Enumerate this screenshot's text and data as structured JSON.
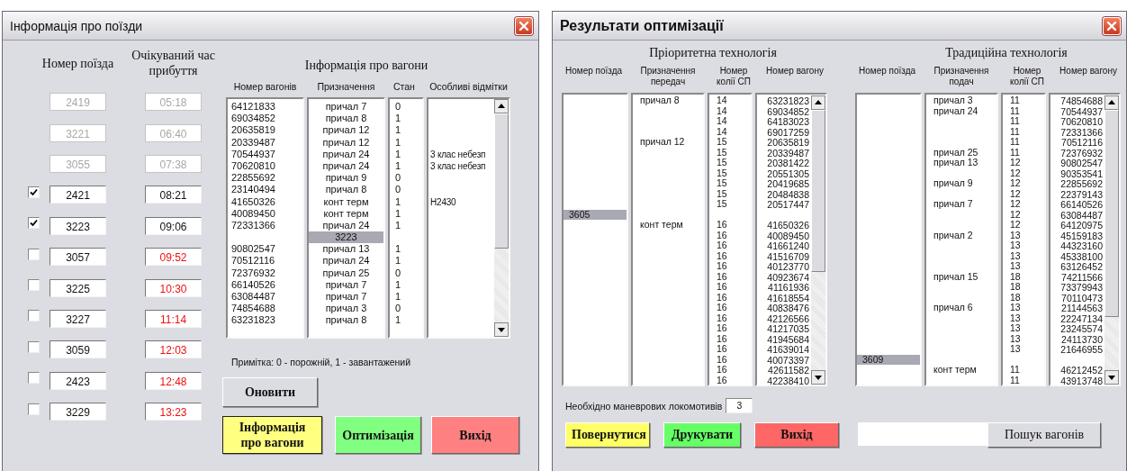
{
  "left_window": {
    "title": "Інформація про поїзди",
    "train_headers": [
      "Номер поїзда",
      "Очікуваний час прибуття"
    ],
    "trains": [
      {
        "number": "2419",
        "time": "05:18",
        "disabled": true,
        "checked": false,
        "late": false
      },
      {
        "number": "3221",
        "time": "06:40",
        "disabled": true,
        "checked": false,
        "late": false
      },
      {
        "number": "3055",
        "time": "07:38",
        "disabled": true,
        "checked": false,
        "late": false
      },
      {
        "number": "2421",
        "time": "08:21",
        "disabled": false,
        "checked": true,
        "late": false
      },
      {
        "number": "3223",
        "time": "09:06",
        "disabled": false,
        "checked": true,
        "late": false
      },
      {
        "number": "3057",
        "time": "09:52",
        "disabled": false,
        "checked": false,
        "late": true
      },
      {
        "number": "3225",
        "time": "10:30",
        "disabled": false,
        "checked": false,
        "late": true
      },
      {
        "number": "3227",
        "time": "11:14",
        "disabled": false,
        "checked": false,
        "late": true
      },
      {
        "number": "3059",
        "time": "12:03",
        "disabled": false,
        "checked": false,
        "late": true
      },
      {
        "number": "2423",
        "time": "12:48",
        "disabled": false,
        "checked": false,
        "late": true
      },
      {
        "number": "3229",
        "time": "13:23",
        "disabled": false,
        "checked": false,
        "late": true
      }
    ],
    "wagon_info": {
      "title": "Інформація про вагони",
      "columns": [
        "Номер вагонів",
        "Призначення",
        "Стан",
        "Особливі відмітки"
      ],
      "rows": [
        {
          "kind": "wagon",
          "wagon": "64121833",
          "destination": "причал 7",
          "state": "0"
        },
        {
          "kind": "wagon",
          "wagon": "69034852",
          "destination": "причал 8",
          "state": "1"
        },
        {
          "kind": "wagon",
          "wagon": "20635819",
          "destination": "причал 12",
          "state": "1"
        },
        {
          "kind": "wagon",
          "wagon": "20339487",
          "destination": "причал 12",
          "state": "1"
        },
        {
          "kind": "wagon",
          "wagon": "70544937",
          "destination": "причал 24",
          "state": "1",
          "note": "3 клас небезп"
        },
        {
          "kind": "wagon",
          "wagon": "70620810",
          "destination": "причал 24",
          "state": "1",
          "note": "3 клас небезп"
        },
        {
          "kind": "wagon",
          "wagon": "22855692",
          "destination": "причал 9",
          "state": "0"
        },
        {
          "kind": "wagon",
          "wagon": "23140494",
          "destination": "причал 8",
          "state": "0"
        },
        {
          "kind": "wagon",
          "wagon": "41650326",
          "destination": "конт терм",
          "state": "1",
          "note": "Н2430"
        },
        {
          "kind": "wagon",
          "wagon": "40089450",
          "destination": "конт терм",
          "state": "1"
        },
        {
          "kind": "wagon",
          "wagon": "72331366",
          "destination": "причал 24",
          "state": "1"
        },
        {
          "kind": "train",
          "number": "3223"
        },
        {
          "kind": "wagon",
          "wagon": "90802547",
          "destination": "причал 13",
          "state": "1"
        },
        {
          "kind": "wagon",
          "wagon": "70512116",
          "destination": "причал 24",
          "state": "1"
        },
        {
          "kind": "wagon",
          "wagon": "72376932",
          "destination": "причал 25",
          "state": "0"
        },
        {
          "kind": "wagon",
          "wagon": "66140526",
          "destination": "причал 7",
          "state": "1"
        },
        {
          "kind": "wagon",
          "wagon": "63084487",
          "destination": "причал 7",
          "state": "1"
        },
        {
          "kind": "wagon",
          "wagon": "74854688",
          "destination": "причал 3",
          "state": "0"
        },
        {
          "kind": "wagon",
          "wagon": "63231823",
          "destination": "причал 8",
          "state": "1"
        }
      ]
    },
    "note": "Примітка:  0 - порожній,  1 - завантажений",
    "refresh_button": "Оновити",
    "buttons": [
      {
        "label": "Інформація про вагони",
        "color": "#ffff80"
      },
      {
        "label": "Оптимізація",
        "color": "#80ff80"
      },
      {
        "label": "Вихід",
        "color": "#ff8080"
      }
    ]
  },
  "right_window": {
    "title": "Результати оптимізації",
    "panels": [
      {
        "title": "Пріоритетна технологія",
        "columns": [
          "Номер поїзда",
          "Призначення передач",
          "Номер колії СП",
          "Номер вагону"
        ],
        "rows": [
          {
            "kind": "wagon",
            "destination": "причал 8",
            "track": "14",
            "wagon": "63231823"
          },
          {
            "kind": "wagon",
            "track": "14",
            "wagon": "69034852"
          },
          {
            "kind": "wagon",
            "track": "14",
            "wagon": "64183023"
          },
          {
            "kind": "wagon",
            "track": "14",
            "wagon": "69017259"
          },
          {
            "kind": "wagon",
            "destination": "причал 12",
            "track": "15",
            "wagon": "20635819"
          },
          {
            "kind": "wagon",
            "track": "15",
            "wagon": "20339487"
          },
          {
            "kind": "wagon",
            "track": "15",
            "wagon": "20381422"
          },
          {
            "kind": "wagon",
            "track": "15",
            "wagon": "20551305"
          },
          {
            "kind": "wagon",
            "track": "15",
            "wagon": "20419685"
          },
          {
            "kind": "wagon",
            "track": "15",
            "wagon": "20484838"
          },
          {
            "kind": "wagon",
            "track": "15",
            "wagon": "20517447"
          },
          {
            "kind": "train",
            "number": "3605"
          },
          {
            "kind": "wagon",
            "destination": "конт терм",
            "track": "16",
            "wagon": "41650326"
          },
          {
            "kind": "wagon",
            "track": "16",
            "wagon": "40089450"
          },
          {
            "kind": "wagon",
            "track": "16",
            "wagon": "41661240"
          },
          {
            "kind": "wagon",
            "track": "16",
            "wagon": "41516709"
          },
          {
            "kind": "wagon",
            "track": "16",
            "wagon": "40123770"
          },
          {
            "kind": "wagon",
            "track": "16",
            "wagon": "40923674"
          },
          {
            "kind": "wagon",
            "track": "16",
            "wagon": "41161936"
          },
          {
            "kind": "wagon",
            "track": "16",
            "wagon": "41618554"
          },
          {
            "kind": "wagon",
            "track": "16",
            "wagon": "40838476"
          },
          {
            "kind": "wagon",
            "track": "16",
            "wagon": "42126566"
          },
          {
            "kind": "wagon",
            "track": "16",
            "wagon": "41217035"
          },
          {
            "kind": "wagon",
            "track": "16",
            "wagon": "41945684"
          },
          {
            "kind": "wagon",
            "track": "16",
            "wagon": "41639014"
          },
          {
            "kind": "wagon",
            "track": "16",
            "wagon": "40073397"
          },
          {
            "kind": "wagon",
            "track": "16",
            "wagon": "42611582"
          },
          {
            "kind": "wagon",
            "track": "16",
            "wagon": "42238410"
          }
        ]
      },
      {
        "title": "Традиційна технологія",
        "columns": [
          "Номер поїзда",
          "Призначення подач",
          "Номер колії СП",
          "Номер вагону"
        ],
        "rows": [
          {
            "kind": "wagon",
            "destination": "причал 3",
            "track": "11",
            "wagon": "74854688"
          },
          {
            "kind": "wagon",
            "destination": "причал 24",
            "track": "11",
            "wagon": "70544937"
          },
          {
            "kind": "wagon",
            "track": "11",
            "wagon": "70620810"
          },
          {
            "kind": "wagon",
            "track": "11",
            "wagon": "72331366"
          },
          {
            "kind": "wagon",
            "track": "11",
            "wagon": "70512116"
          },
          {
            "kind": "wagon",
            "destination": "причал 25",
            "track": "11",
            "wagon": "72376932"
          },
          {
            "kind": "wagon",
            "destination": "причал 13",
            "track": "12",
            "wagon": "90802547"
          },
          {
            "kind": "wagon",
            "track": "12",
            "wagon": "90353541"
          },
          {
            "kind": "wagon",
            "destination": "причал 9",
            "track": "12",
            "wagon": "22855692"
          },
          {
            "kind": "wagon",
            "track": "12",
            "wagon": "22379143"
          },
          {
            "kind": "wagon",
            "destination": "причал 7",
            "track": "12",
            "wagon": "66140526"
          },
          {
            "kind": "wagon",
            "track": "12",
            "wagon": "63084487"
          },
          {
            "kind": "wagon",
            "track": "12",
            "wagon": "64120975"
          },
          {
            "kind": "wagon",
            "destination": "причал 2",
            "track": "13",
            "wagon": "45159183"
          },
          {
            "kind": "wagon",
            "track": "13",
            "wagon": "44323160"
          },
          {
            "kind": "wagon",
            "track": "13",
            "wagon": "45338100"
          },
          {
            "kind": "wagon",
            "track": "13",
            "wagon": "63126452"
          },
          {
            "kind": "wagon",
            "destination": "причал 15",
            "track": "18",
            "wagon": "74211566"
          },
          {
            "kind": "wagon",
            "track": "18",
            "wagon": "73379943"
          },
          {
            "kind": "wagon",
            "track": "18",
            "wagon": "70110473"
          },
          {
            "kind": "wagon",
            "destination": "причал 6",
            "track": "13",
            "wagon": "21144563"
          },
          {
            "kind": "wagon",
            "track": "13",
            "wagon": "22247134"
          },
          {
            "kind": "wagon",
            "track": "13",
            "wagon": "23245574"
          },
          {
            "kind": "wagon",
            "track": "13",
            "wagon": "24113730"
          },
          {
            "kind": "wagon",
            "track": "13",
            "wagon": "21646955"
          },
          {
            "kind": "train",
            "number": "3609"
          },
          {
            "kind": "wagon",
            "destination": "конт терм",
            "track": "11",
            "wagon": "46212452"
          },
          {
            "kind": "wagon",
            "track": "11",
            "wagon": "43913748"
          }
        ]
      }
    ],
    "locomotives": {
      "label": "Необхідно маневрових локомотивів",
      "value": "3"
    },
    "buttons": [
      {
        "label": "Повернутися",
        "color": "#ffff66"
      },
      {
        "label": "Друкувати",
        "color": "#66ff66"
      },
      {
        "label": "Вихід",
        "color": "#ff6666"
      }
    ],
    "search_button": "Пошук вагонів"
  }
}
